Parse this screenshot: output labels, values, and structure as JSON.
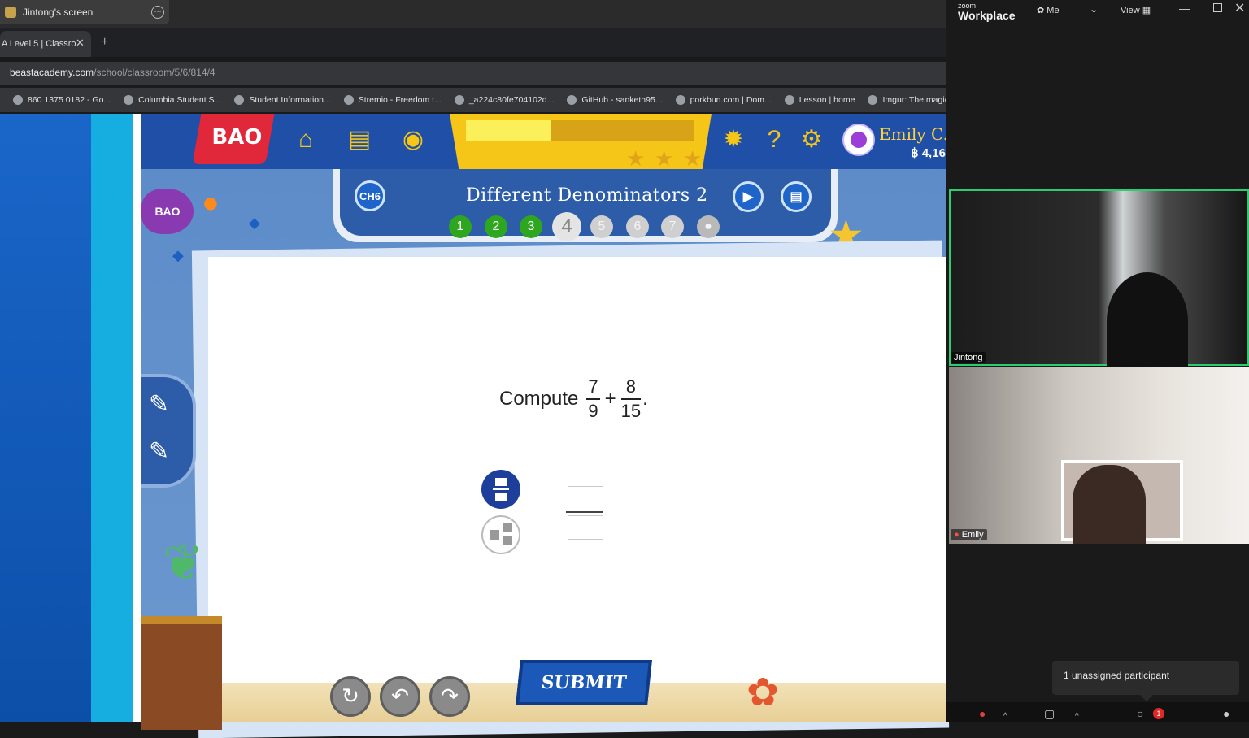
{
  "zoom_share": {
    "tab_label": "Jintong's screen"
  },
  "browser": {
    "tab_title": "A Level 5 | Classro",
    "url_domain": "beastacademy.com",
    "url_path": "/school/classroom/5/6/814/4",
    "bookmarks": [
      "860 1375 0182 - Go...",
      "Columbia Student S...",
      "Student Information...",
      "Stremio - Freedom t...",
      "_a224c80fe704102d...",
      "GitHub - sanketh95...",
      "porkbun.com | Dom...",
      "Lesson | home",
      "Imgur: The magic"
    ]
  },
  "game": {
    "logo": "BAO",
    "user_name": "Emily C...",
    "coins": "฿ 4,16",
    "chapter_badge": "CH6",
    "lesson_title": "Different Denominators 2",
    "progress_fraction": 0.37,
    "steps": [
      "1",
      "2",
      "3",
      "4",
      "5",
      "6",
      "7"
    ],
    "current_step": "4",
    "question_prefix": "Compute",
    "frac1_num": "7",
    "frac1_den": "9",
    "operator": "+",
    "frac2_num": "8",
    "frac2_den": "15",
    "question_suffix": ".",
    "submit_label": "SUBMIT",
    "fish_label": "BAO",
    "stars": [
      "★",
      "★",
      "★"
    ]
  },
  "zoom": {
    "brand_small": "zoom",
    "brand_big": "Workplace",
    "me_label": "Me",
    "view_label": "View",
    "participants": [
      {
        "name": "Jintong"
      },
      {
        "name": "Emily"
      }
    ],
    "tooltip": "1 unassigned participant",
    "chat_badge": "1"
  }
}
